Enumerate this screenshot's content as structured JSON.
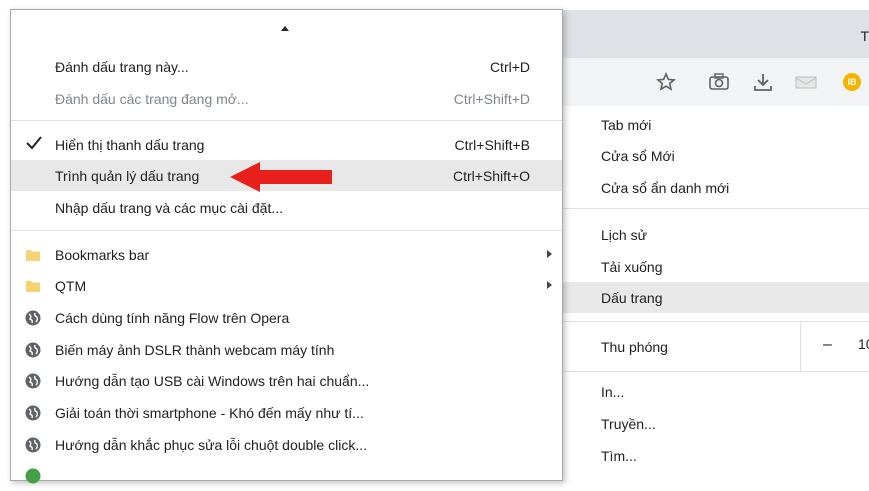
{
  "window": {
    "tab_edge_glyph": "T"
  },
  "toolbar": {
    "icons": [
      "star-icon",
      "camera-icon",
      "download-icon",
      "mail-icon",
      "avatar-icon"
    ],
    "avatar_text": "IB"
  },
  "bookmarks_menu": {
    "items": [
      {
        "label": "Đánh dấu trang này...",
        "shortcut": "Ctrl+D",
        "disabled": false
      },
      {
        "label": "Đánh dấu các trang đang mở...",
        "shortcut": "Ctrl+Shift+D",
        "disabled": true
      },
      {
        "label": "Hiển thị thanh dấu trang",
        "shortcut": "Ctrl+Shift+B",
        "checked": true
      },
      {
        "label": "Trình quản lý dấu trang",
        "shortcut": "Ctrl+Shift+O",
        "highlighted": true
      },
      {
        "label": "Nhập dấu trang và các mục cài đặt..."
      }
    ],
    "folders": [
      {
        "label": "Bookmarks bar"
      },
      {
        "label": "QTM"
      }
    ],
    "bookmarks": [
      {
        "label": "Cách dùng tính năng Flow trên Opera"
      },
      {
        "label": "Biến máy ảnh DSLR thành webcam máy tính"
      },
      {
        "label": "Hướng dẫn tạo USB cài Windows trên hai chuẩn..."
      },
      {
        "label": "Giải toán thời smartphone - Khó đến mấy như tí..."
      },
      {
        "label": "Hướng dẫn khắc phục sửa lỗi chuột double click..."
      }
    ]
  },
  "main_menu": {
    "items": [
      {
        "label": "Tab mới"
      },
      {
        "label": "Cửa sổ Mới"
      },
      {
        "label": "Cửa sổ ẩn danh mới"
      },
      {
        "label": "Lịch sử"
      },
      {
        "label": "Tải xuống"
      },
      {
        "label": "Dấu trang",
        "active": true
      },
      {
        "label": "Thu phóng"
      },
      {
        "label": "In..."
      },
      {
        "label": "Truyền..."
      },
      {
        "label": "Tìm..."
      }
    ],
    "zoom_minus": "–",
    "zoom_value": "10"
  },
  "colors": {
    "arrow": "#e8211c",
    "folder": "#f6d372",
    "menu_hover": "#e8e8e8"
  }
}
